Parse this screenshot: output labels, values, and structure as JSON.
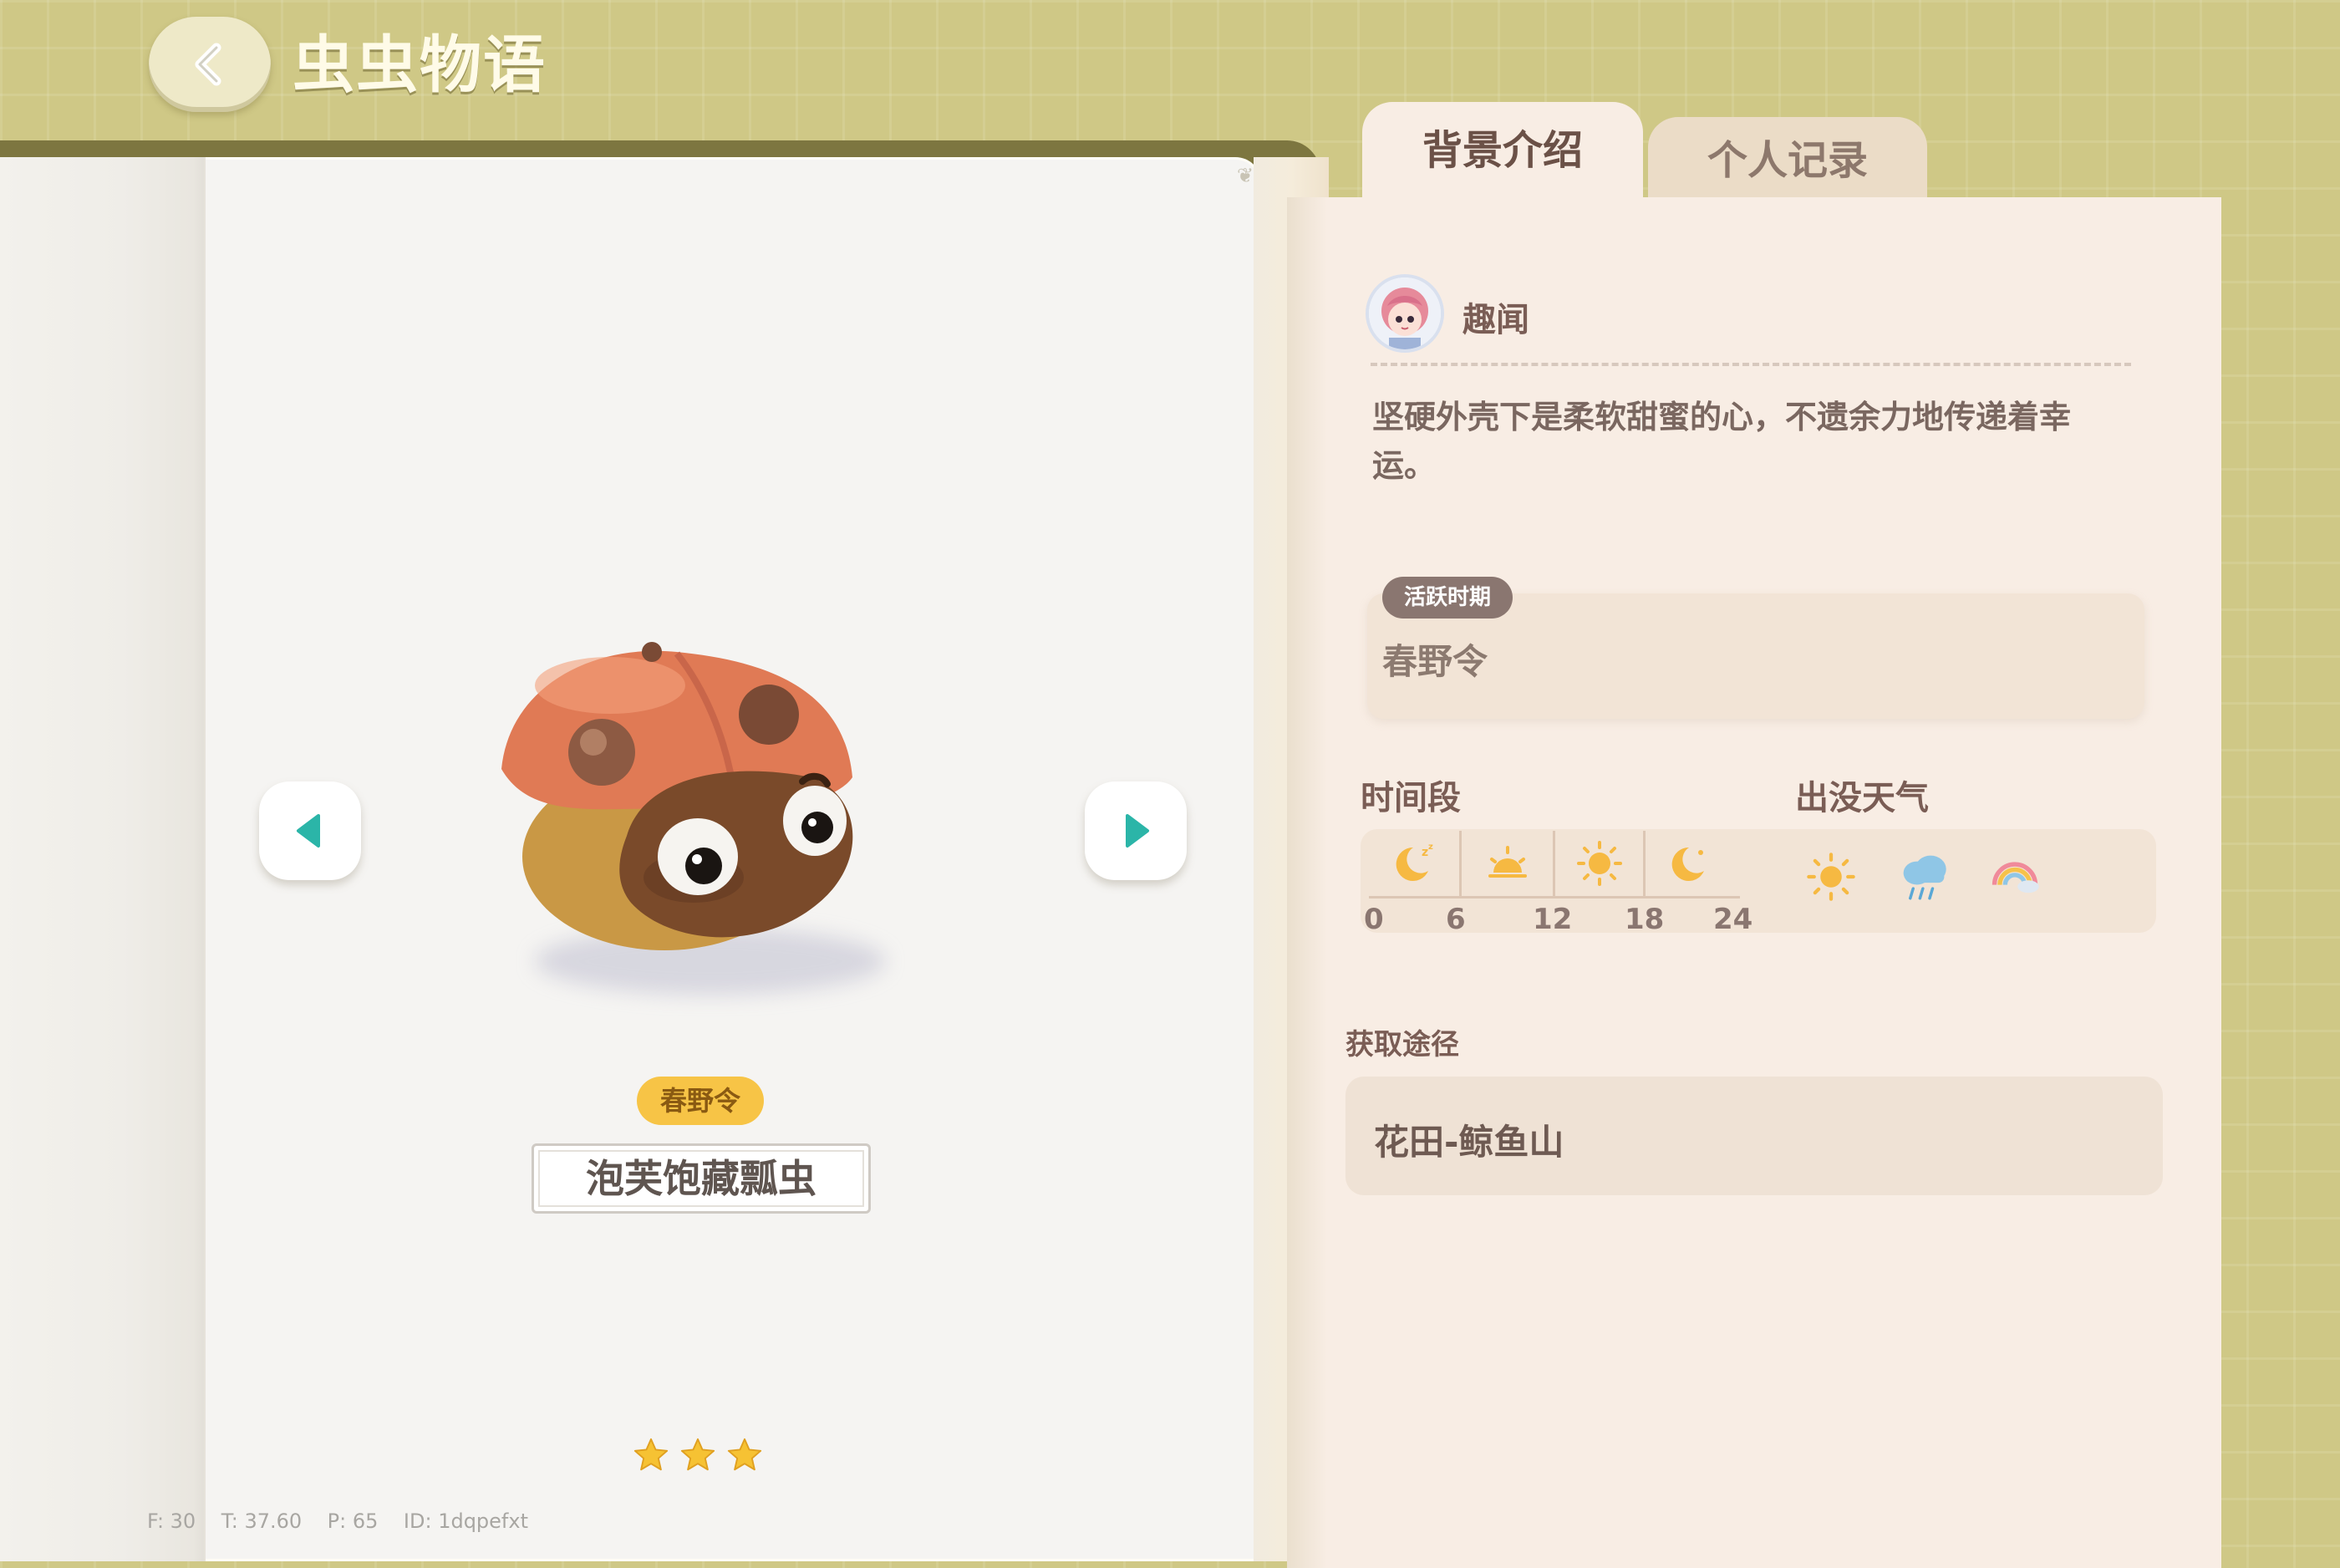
{
  "header": {
    "title": "虫虫物语"
  },
  "tabs": [
    {
      "label": "背景介绍",
      "active": true
    },
    {
      "label": "个人记录",
      "active": false
    }
  ],
  "creature": {
    "season_badge": "春野令",
    "name": "泡芙饱藏瓢虫",
    "rarity_stars": 3
  },
  "fun_fact": {
    "label": "趣闻",
    "text": "坚硬外壳下是柔软甜蜜的心，不遗余力地传递着幸运。"
  },
  "active_period": {
    "tag": "活跃时期",
    "value": "春野令"
  },
  "time_period": {
    "label": "时间段",
    "ticks": [
      "0",
      "6",
      "12",
      "18",
      "24"
    ],
    "icons": [
      "sleeping-moon-icon",
      "sunrise-icon",
      "sun-icon",
      "moon-icon"
    ]
  },
  "weather": {
    "label": "出没天气",
    "icons": [
      "sun-icon",
      "rain-cloud-icon",
      "rainbow-icon"
    ]
  },
  "acquisition": {
    "label": "获取途径",
    "value": "花田-鲸鱼山"
  },
  "debug": {
    "text": "F: 30    T: 37.60    P: 65    ID: 1dqpefxt"
  },
  "colors": {
    "accent": "#f7c446",
    "arrow": "#2bb5a8",
    "title": "#fffbe8"
  }
}
